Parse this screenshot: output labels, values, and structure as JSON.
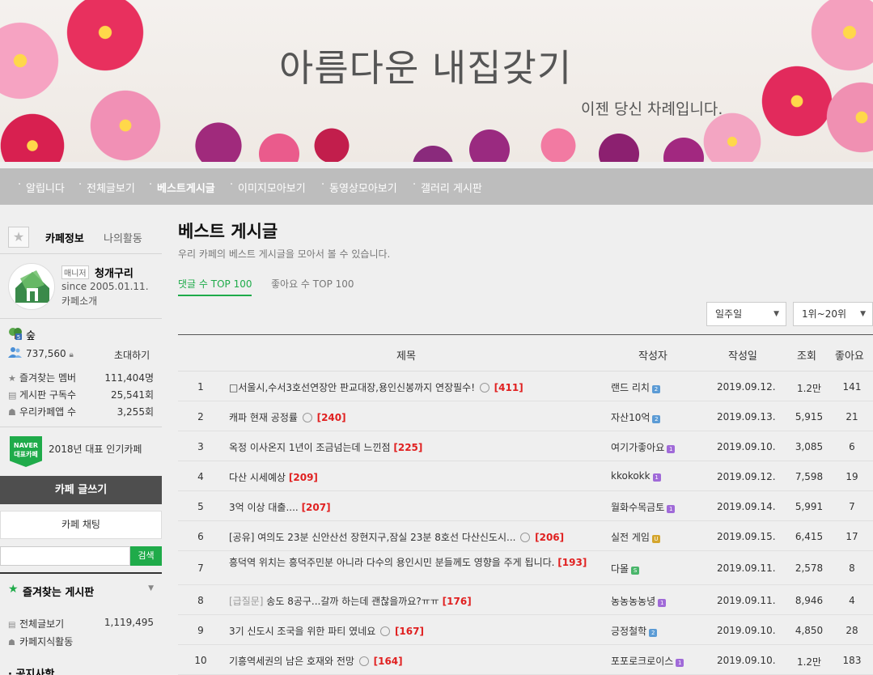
{
  "banner": {
    "title": "아름다운 내집갖기",
    "subtitle": "이젠 당신 차례입니다."
  },
  "nav": [
    {
      "label": "알립니다",
      "active": false
    },
    {
      "label": "전체글보기",
      "active": false
    },
    {
      "label": "베스트게시글",
      "active": true
    },
    {
      "label": "이미지모아보기",
      "active": false
    },
    {
      "label": "동영상모아보기",
      "active": false
    },
    {
      "label": "갤러리 게시판",
      "active": false
    }
  ],
  "sidebar": {
    "tab_cafe": "카페정보",
    "tab_activity": "나의활동",
    "manager_badge": "매니저",
    "manager_name": "청개구리",
    "since": "since 2005.01.11.",
    "intro": "카페소개",
    "level_badge": "5",
    "level": "숲",
    "members": "737,560",
    "invite": "초대하기",
    "stats": [
      {
        "label": "즐겨찾는 멤버",
        "value": "111,404명"
      },
      {
        "label": "게시판 구독수",
        "value": "25,541회"
      },
      {
        "label": "우리카페앱 수",
        "value": "3,255회"
      }
    ],
    "naver_badge": [
      "NAVER",
      "대표카페"
    ],
    "popular": "2018년 대표 인기카페",
    "write_button": "카페 글쓰기",
    "chat_button": "카페 채팅",
    "search_placeholder": "",
    "search_button": "검색",
    "fav_title": "즐겨찾는 게시판",
    "boards": [
      {
        "label": "전체글보기",
        "value": "1,119,495"
      },
      {
        "label": "카페지식활동",
        "value": ""
      }
    ],
    "notice": "공지사항"
  },
  "main": {
    "title": "베스트 게시글",
    "desc": "우리 카페의 베스트 게시글을 모아서 볼 수 있습니다.",
    "tabs": [
      "댓글 수 TOP 100",
      "좋아요 수 TOP 100"
    ],
    "period": "일주일",
    "range": "1위~20위",
    "headers": {
      "title": "제목",
      "author": "작성자",
      "date": "작성일",
      "views": "조회",
      "likes": "좋아요"
    },
    "rows": [
      {
        "num": "1",
        "prefix": "",
        "title": "□서울시,수서3호선연장안 판교대장,용인신봉까지 연장필수!",
        "img": true,
        "comments": "[411]",
        "author": "랜드 리치",
        "lv": "blue",
        "lv_text": "2",
        "date": "2019.09.12.",
        "views": "1.2만",
        "likes": "141"
      },
      {
        "num": "2",
        "prefix": "",
        "title": "캐파 현재 공정률",
        "img": true,
        "comments": "[240]",
        "author": "자산10억",
        "lv": "blue",
        "lv_text": "2",
        "date": "2019.09.13.",
        "views": "5,915",
        "likes": "21"
      },
      {
        "num": "3",
        "prefix": "",
        "title": "옥정 이사온지 1년이 조금넘는데 느낀점",
        "img": false,
        "comments": "[225]",
        "author": "여기가좋아요",
        "lv": "purple",
        "lv_text": "1",
        "date": "2019.09.10.",
        "views": "3,085",
        "likes": "6"
      },
      {
        "num": "4",
        "prefix": "",
        "title": "다산 시세예상",
        "img": false,
        "comments": "[209]",
        "author": "kkokokk",
        "lv": "purple",
        "lv_text": "1",
        "date": "2019.09.12.",
        "views": "7,598",
        "likes": "19"
      },
      {
        "num": "5",
        "prefix": "",
        "title": "3억 이상 대출....",
        "img": false,
        "comments": "[207]",
        "author": "월화수목금토",
        "lv": "purple",
        "lv_text": "1",
        "date": "2019.09.14.",
        "views": "5,991",
        "likes": "7"
      },
      {
        "num": "6",
        "prefix": "",
        "title": "[공유] 여의도 23분 신안산선 장현지구,잠실 23분 8호선 다산신도시...",
        "img": true,
        "comments": "[206]",
        "author": "실전 게임",
        "lv": "yellow",
        "lv_text": "U",
        "date": "2019.09.15.",
        "views": "6,415",
        "likes": "17"
      },
      {
        "num": "7",
        "prefix": "",
        "title": "흥덕역 위치는 흥덕주민분 아니라 다수의 용인시민 분들께도 영향을 주게 됩니다.",
        "img": false,
        "comments": "[193]",
        "author": "다몰",
        "lv": "green",
        "lv_text": "S",
        "date": "2019.09.11.",
        "views": "2,578",
        "likes": "8"
      },
      {
        "num": "8",
        "prefix": "[급질문]",
        "title": " 송도 8공구...갈까 하는데 괜찮을까요?ㅠㅠ",
        "img": false,
        "comments": "[176]",
        "author": "농농농농녕",
        "lv": "purple",
        "lv_text": "1",
        "date": "2019.09.11.",
        "views": "8,946",
        "likes": "4"
      },
      {
        "num": "9",
        "prefix": "",
        "title": "3기 신도시 조국을 위한 파티 였네요",
        "img": true,
        "comments": "[167]",
        "author": "긍정철학",
        "lv": "blue",
        "lv_text": "2",
        "date": "2019.09.10.",
        "views": "4,850",
        "likes": "28"
      },
      {
        "num": "10",
        "prefix": "",
        "title": "기흥역세권의 남은 호재와 전망",
        "img": true,
        "comments": "[164]",
        "author": "포포로크로이스",
        "lv": "purple",
        "lv_text": "1",
        "date": "2019.09.10.",
        "views": "1.2만",
        "likes": "183"
      }
    ]
  }
}
